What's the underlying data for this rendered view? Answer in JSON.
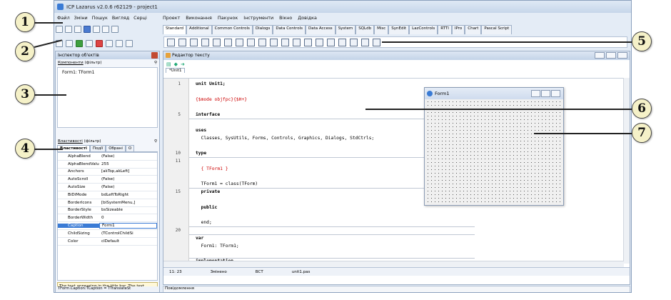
{
  "window_title": "ICP Lazarus v2.0.6 r62129 - project1",
  "menu_left": [
    "Файл",
    "Зміни",
    "Пошук",
    "Вигляд",
    "Серці"
  ],
  "menu_right": [
    "Проект",
    "Виконання",
    "Пакунок",
    "Інструменти",
    "Вікно",
    "Довідка"
  ],
  "palette_tabs": [
    "Standard",
    "Additional",
    "Common Controls",
    "Dialogs",
    "Data Controls",
    "Data Access",
    "System",
    "SQLdb",
    "Misc",
    "SynEdit",
    "LazControls",
    "RTTI",
    "IPro",
    "Chart",
    "Pascal Script"
  ],
  "inspector": {
    "title": "Інспектор об'єктів",
    "components_label": "Компоненти",
    "filter_placeholder": "(фільтр)",
    "tree_item": "Form1: TForm1",
    "properties_label": "Властивості",
    "tabs": [
      "Властивості",
      "Події",
      "Обрані",
      "О"
    ],
    "props": [
      {
        "n": "AlphaBlend",
        "v": "(False)"
      },
      {
        "n": "AlphaBlendValu",
        "v": "255"
      },
      {
        "n": "Anchors",
        "v": "[akTop,akLeft]"
      },
      {
        "n": "AutoScroll",
        "v": "(False)"
      },
      {
        "n": "AutoSize",
        "v": "(False)"
      },
      {
        "n": "BiDiMode",
        "v": "bdLeftToRight"
      },
      {
        "n": "BorderIcons",
        "v": "[biSystemMenu,]"
      },
      {
        "n": "BorderStyle",
        "v": "bsSizeable"
      },
      {
        "n": "BorderWidth",
        "v": "0"
      },
      {
        "n": "Caption",
        "v": "Form1"
      },
      {
        "n": "ChildSizing",
        "v": "(TControlChildSi"
      },
      {
        "n": "Color",
        "v": "clDefault"
      }
    ],
    "hint": "The text appearing in the title bar. The text describing the control to ...",
    "status": "TForm.Caption:TCaption = TTranslateSt"
  },
  "editor": {
    "title": "Редактор тексту",
    "tab": "*Unit1",
    "lines": [
      {
        "num": "1",
        "text": "unit Unit1;",
        "cls": "kw"
      },
      {
        "num": "",
        "text": "",
        "cls": ""
      },
      {
        "num": "",
        "text": "{$mode objfpc}{$H+}",
        "cls": "cm"
      },
      {
        "num": "",
        "text": "",
        "cls": ""
      },
      {
        "num": "5",
        "text": "interface",
        "cls": "kw"
      },
      {
        "num": "",
        "text": "",
        "cls": ""
      },
      {
        "num": "",
        "text": "uses",
        "cls": "kw"
      },
      {
        "num": "",
        "text": "  Classes, SysUtils, Forms, Controls, Graphics, Dialogs, StdCtrls;",
        "cls": ""
      },
      {
        "num": "",
        "text": "",
        "cls": ""
      },
      {
        "num": "10",
        "text": "type",
        "cls": "kw"
      },
      {
        "num": "11",
        "text": "",
        "cls": ""
      },
      {
        "num": "",
        "text": "  { TForm1 }",
        "cls": "cm"
      },
      {
        "num": "",
        "text": "",
        "cls": ""
      },
      {
        "num": "",
        "text": "  TForm1 = class(TForm)",
        "cls": ""
      },
      {
        "num": "15",
        "text": "  private",
        "cls": "kw"
      },
      {
        "num": "",
        "text": "",
        "cls": ""
      },
      {
        "num": "",
        "text": "  public",
        "cls": "kw"
      },
      {
        "num": "",
        "text": "",
        "cls": ""
      },
      {
        "num": "",
        "text": "  end;",
        "cls": ""
      },
      {
        "num": "20",
        "text": "",
        "cls": ""
      },
      {
        "num": "",
        "text": "var",
        "cls": "kw"
      },
      {
        "num": "",
        "text": "  Form1: TForm1;",
        "cls": ""
      },
      {
        "num": "",
        "text": "",
        "cls": ""
      },
      {
        "num": "",
        "text": "implementation",
        "cls": "kw"
      }
    ],
    "status_pos": "11: 23",
    "status_mode": "Змінено",
    "status_ins": "ВСТ",
    "status_file": "unit1.pas",
    "messages": "Повідомлення"
  },
  "form1": {
    "title": "Form1"
  },
  "callouts": [
    "1",
    "2",
    "3",
    "4",
    "5",
    "6",
    "7"
  ]
}
